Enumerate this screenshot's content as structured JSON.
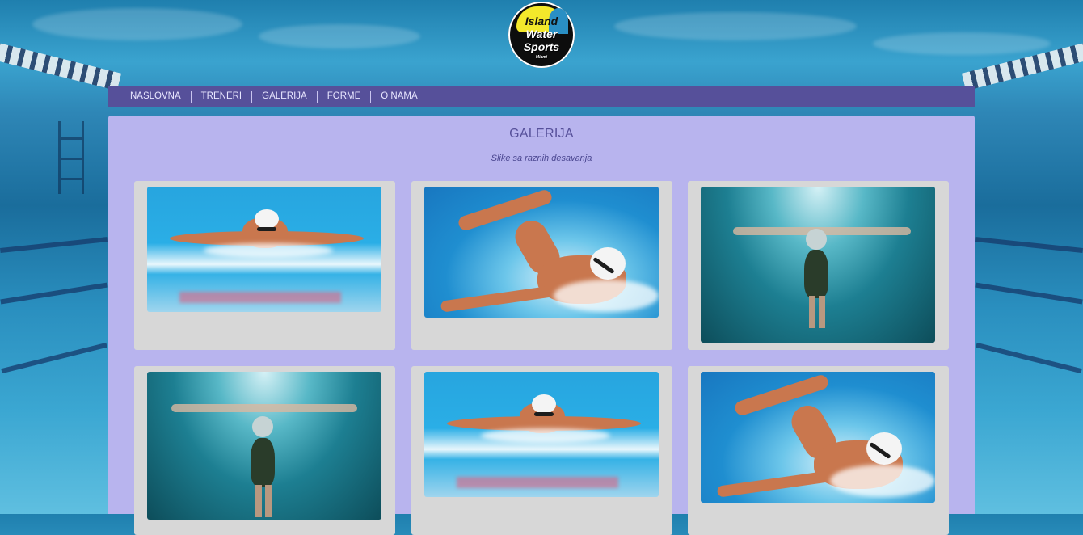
{
  "brand": {
    "logo_line1": "Island",
    "logo_line2": "Water",
    "logo_line3": "Sports",
    "logo_line4": "Miami"
  },
  "nav": {
    "items": [
      "NASLOVNA",
      "TRENERI",
      "GALERIJA",
      "FORME",
      "O NAMA"
    ]
  },
  "page": {
    "title": "GALERIJA",
    "subtitle": "Slike sa raznih desavanja"
  },
  "gallery": [
    {
      "scene": "butterfly"
    },
    {
      "scene": "freestyle"
    },
    {
      "scene": "underwater"
    },
    {
      "scene": "underwater"
    },
    {
      "scene": "butterfly"
    },
    {
      "scene": "freestyle"
    }
  ],
  "colors": {
    "nav_bg": "#56509a",
    "content_bg": "#b8b4ee",
    "card_bg": "#d7d7d7",
    "title": "#56509a"
  }
}
